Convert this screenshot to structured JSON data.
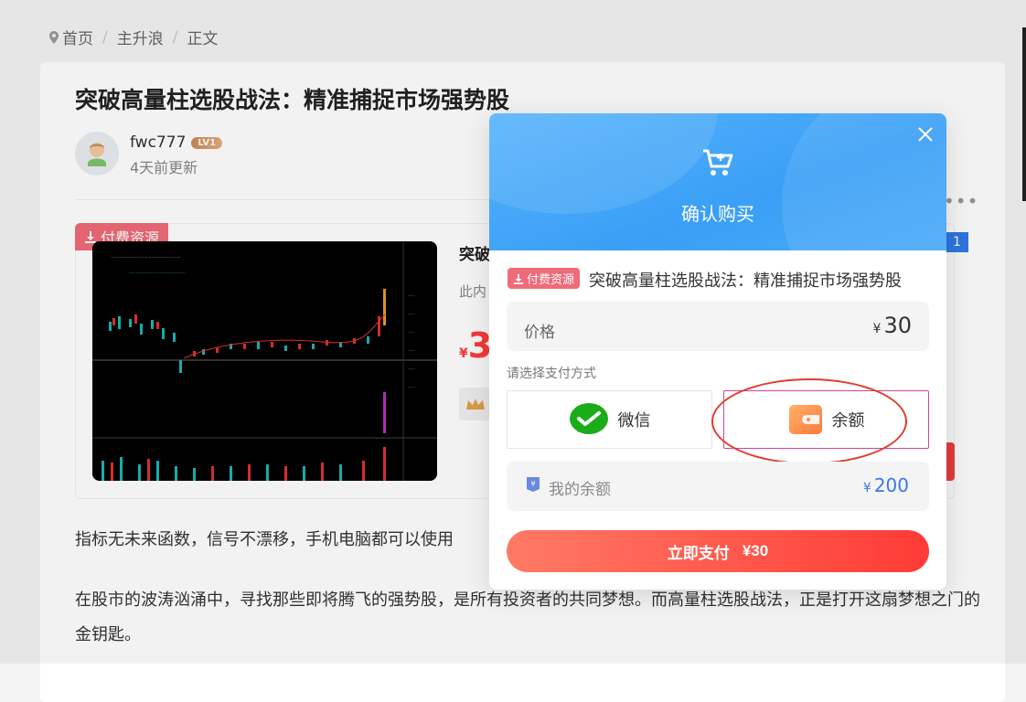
{
  "breadcrumb": [
    "首页",
    "主升浪",
    "正文"
  ],
  "article": {
    "title": "突破高量柱选股战法：精准捕捉市场强势股",
    "author": "fwc777",
    "level": "LV1",
    "updated": "4天前更新",
    "paid_tag": "付费资源",
    "res_title": "突破",
    "res_desc": "此内",
    "res_price_symbol": "¥",
    "res_price_digit": "3",
    "blue_badge": "1",
    "para1": "指标无未来函数，信号不漂移，手机电脑都可以使用",
    "para2": "在股市的波涛汹涌中，寻找那些即将腾飞的强势股，是所有投资者的共同梦想。而高量柱选股战法，正是打开这扇梦想之门的金钥匙。"
  },
  "modal": {
    "header_title": "确认购买",
    "tag": "付费资源",
    "resource_title": "突破高量柱选股战法：精准捕捉市场强势股",
    "price_label": "价格",
    "price_symbol": "¥",
    "price_value": "30",
    "choose_label": "请选择支付方式",
    "methods": [
      {
        "label": "微信",
        "icon": "wechat-icon",
        "selected": false
      },
      {
        "label": "余额",
        "icon": "wallet-icon",
        "selected": true
      }
    ],
    "balance_label": "我的余额",
    "balance_symbol": "¥",
    "balance_value": "200",
    "pay_button": "立即支付",
    "pay_amount": "¥30"
  },
  "colors": {
    "header_blue": "#3a9ff6",
    "tag_pink": "#f06b78",
    "pay_red": "#ff3b36",
    "balance_blue": "#3a78e6",
    "selected_border": "#d0439a",
    "annotation_red": "#e23b2c"
  }
}
